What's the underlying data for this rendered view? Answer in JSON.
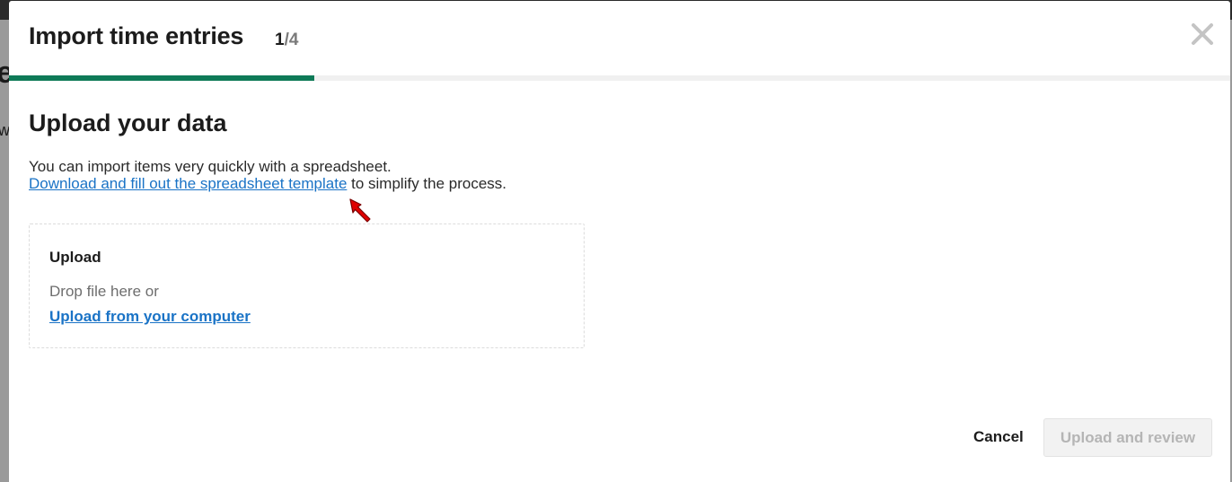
{
  "background": {
    "edge_glyph_e": "e",
    "edge_glyph_w": "w"
  },
  "dialog": {
    "title": "Import time entries",
    "step_current": "1",
    "step_separator": "/",
    "step_total": "4",
    "progress_fraction": 0.25,
    "close_icon": "close-icon"
  },
  "section": {
    "heading": "Upload your data",
    "intro": "You can import items very quickly with a spreadsheet.",
    "template_link": "Download and fill out the spreadsheet template",
    "template_suffix": " to simplify the process."
  },
  "upload": {
    "title": "Upload",
    "drop_text": "Drop file here or",
    "browse_link": "Upload from your computer"
  },
  "footer": {
    "cancel_label": "Cancel",
    "submit_label": "Upload and review"
  },
  "colors": {
    "accent": "#0e7a57",
    "link": "#1a73c6",
    "disabled_text": "#b5b5b5",
    "cursor": "#e00000"
  }
}
